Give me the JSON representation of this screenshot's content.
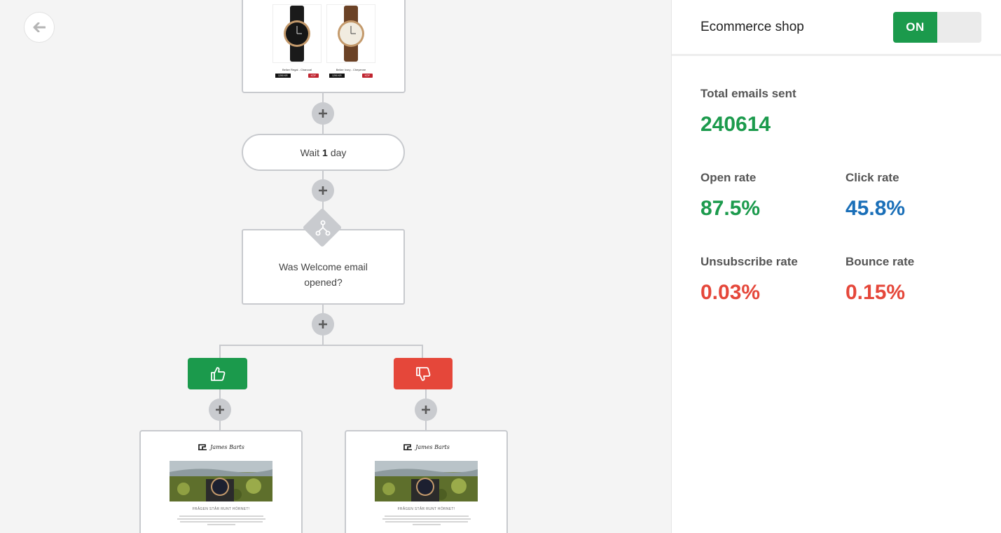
{
  "canvas": {
    "wait_node": {
      "prefix": "Wait",
      "amount": "1",
      "unit": "day"
    },
    "condition_node": {
      "text": "Was Welcome email opened?"
    },
    "product_email": {
      "products": [
        {
          "name": "Belize Regal - Charcoal",
          "price": "1290 KR",
          "buy": "KÖP"
        },
        {
          "name": "Belize Ivory - Cheyenne",
          "price": "1290 KR",
          "buy": "KÖP"
        }
      ]
    },
    "newsletter_cards": [
      {
        "logo": "James Barts",
        "heading": "FRÅGEN STÅR RUNT HÖRNET!"
      },
      {
        "logo": "James Barts",
        "heading": "FRÅGEN STÅR RUNT HÖRNET!"
      }
    ],
    "colors": {
      "yes": "#1b9a4c",
      "no": "#e5473a",
      "connector": "#c8cace"
    }
  },
  "panel": {
    "shop_name": "Ecommerce shop",
    "toggle": {
      "on_label": "ON",
      "state": "on"
    },
    "stats": {
      "total_sent": {
        "label": "Total emails sent",
        "value": "240614",
        "color": "#1b9a4c"
      },
      "open_rate": {
        "label": "Open rate",
        "value": "87.5%",
        "color": "#1b9a4c"
      },
      "click_rate": {
        "label": "Click rate",
        "value": "45.8%",
        "color": "#1a6fb8"
      },
      "unsubscribe_rate": {
        "label": "Unsubscribe rate",
        "value": "0.03%",
        "color": "#e5473a"
      },
      "bounce_rate": {
        "label": "Bounce rate",
        "value": "0.15%",
        "color": "#e5473a"
      }
    }
  }
}
